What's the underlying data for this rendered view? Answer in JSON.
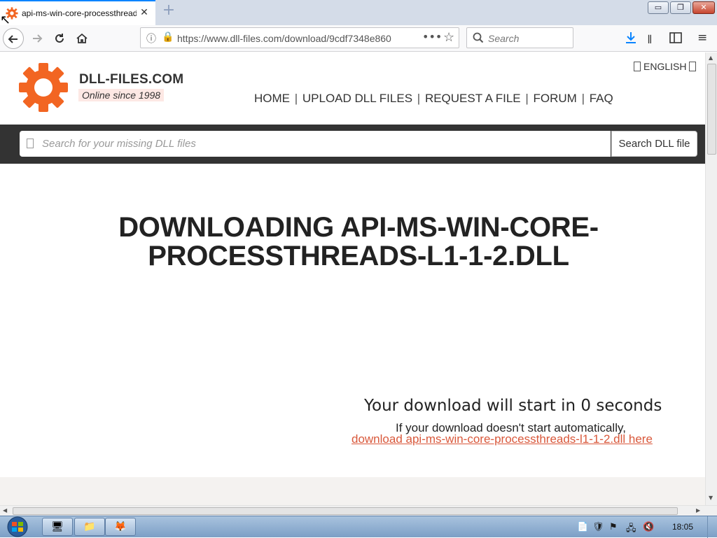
{
  "browser": {
    "tab_title": "api-ms-win-core-processthreads",
    "tab_close": "✕",
    "new_tab": "+",
    "url": "https://www.dll-files.com/download/9cdf7348e860",
    "search_placeholder": "Search",
    "window_controls": {
      "minimize": "▭",
      "maximize": "❐",
      "close": "✕"
    }
  },
  "site": {
    "name": "DLL-FILES.COM",
    "tagline": "Online since 1998",
    "language": "ENGLISH",
    "nav": [
      "HOME",
      "UPLOAD DLL FILES",
      "REQUEST A FILE",
      "FORUM",
      "FAQ"
    ],
    "nav_separator": "|",
    "search_placeholder": "Search for your missing DLL files",
    "search_button": "Search DLL file",
    "brand_color": "#f26522"
  },
  "main": {
    "headline_line1": "DOWNLOADING API-MS-WIN-CORE-",
    "headline_line2": "PROCESSTHREADS-L1-1-2.DLL",
    "countdown": "Your download will start in 0 seconds",
    "fallback_text": "If your download doesn't start automatically,",
    "download_link": "download api-ms-win-core-processthreads-l1-1-2.dll here",
    "link_color": "#d9583b"
  },
  "taskbar": {
    "clock": "18:05"
  }
}
